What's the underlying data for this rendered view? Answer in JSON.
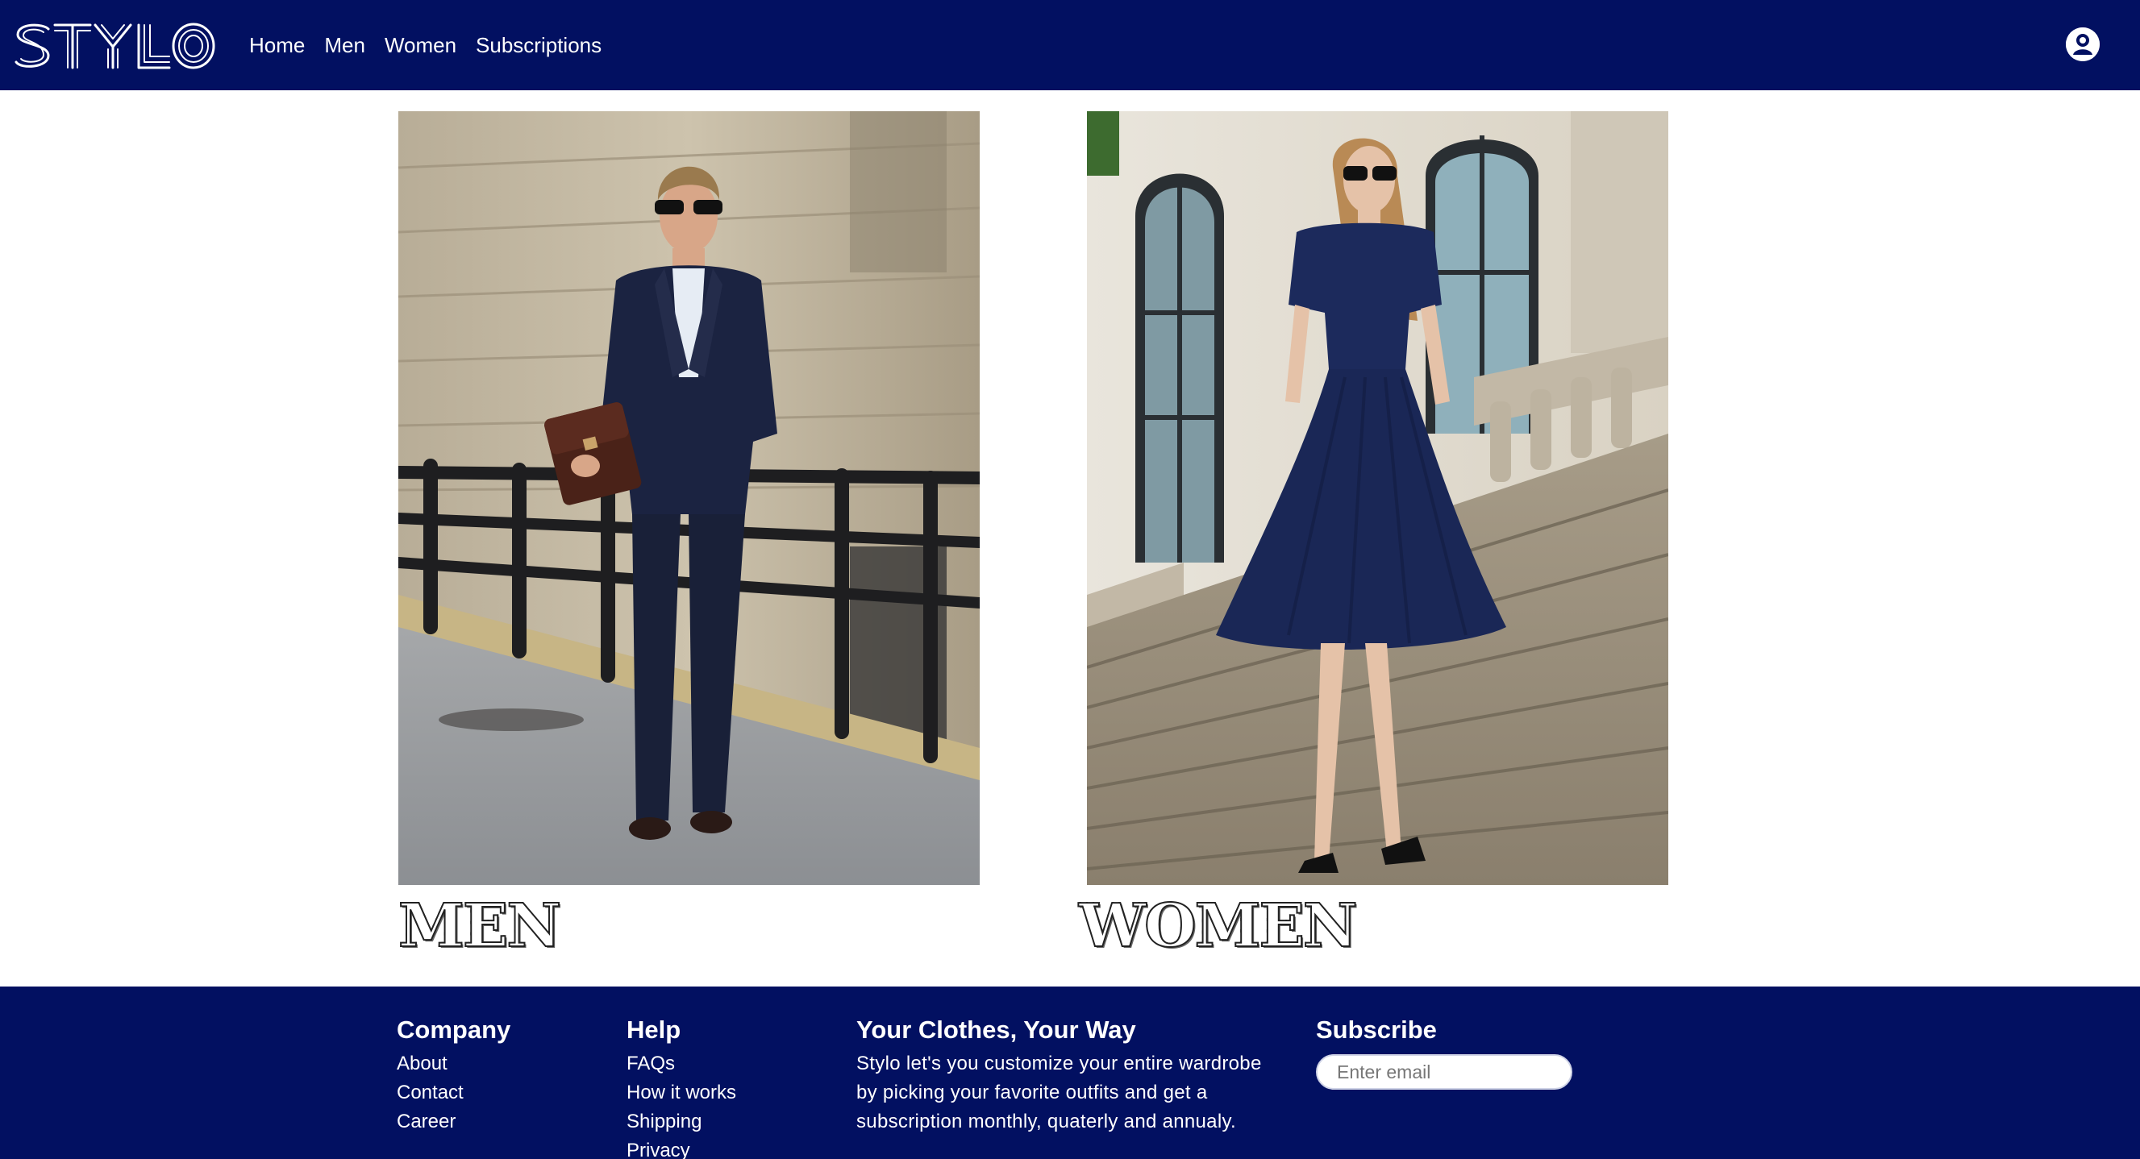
{
  "brand": {
    "logo_text": "STYLO",
    "primary_color": "#021061"
  },
  "nav": {
    "links": [
      {
        "label": "Home"
      },
      {
        "label": "Men"
      },
      {
        "label": "Women"
      },
      {
        "label": "Subscriptions"
      }
    ],
    "account_icon": "user-circle-icon"
  },
  "categories": [
    {
      "title": "MEN",
      "image": "man in navy suit with brown leather bag walking past a railing"
    },
    {
      "title": "WOMEN",
      "image": "woman in navy dress and sunglasses on stone steps"
    }
  ],
  "footer": {
    "company": {
      "heading": "Company",
      "links": [
        "About",
        "Contact",
        "Career"
      ]
    },
    "help": {
      "heading": "Help",
      "links": [
        "FAQs",
        "How it works",
        "Shipping",
        "Privacy"
      ]
    },
    "about": {
      "heading": "Your Clothes, Your Way",
      "text": "Stylo let's you customize your entire wardrobe by picking your favorite outfits and get a subscription monthly, quaterly and annualy."
    },
    "subscribe": {
      "heading": "Subscribe",
      "placeholder": "Enter email"
    }
  }
}
